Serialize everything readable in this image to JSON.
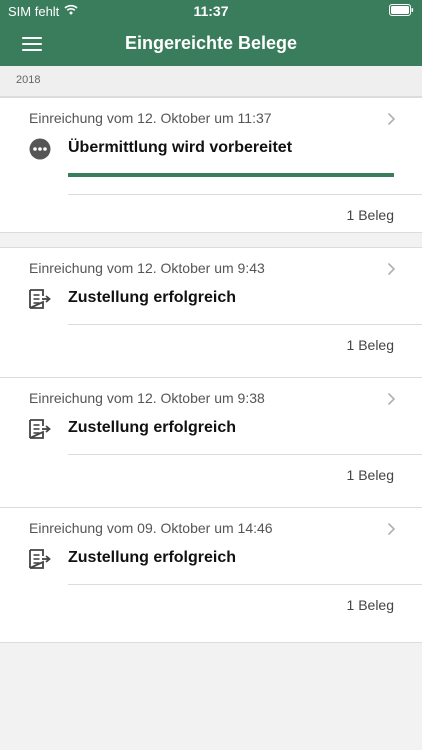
{
  "statusbar": {
    "carrier": "SIM fehlt",
    "time": "11:37"
  },
  "header": {
    "title": "Eingereichte Belege"
  },
  "section": {
    "label": "2018"
  },
  "colors": {
    "brand": "#3a7d5c",
    "background": "#f2f2f2",
    "card": "#ffffff"
  },
  "submissions": [
    {
      "date": "Einreichung vom 12. Oktober um 11:37",
      "status": "Übermittlung wird vorbereitet",
      "status_icon": "more-dots-icon",
      "progress": 1.0,
      "count": "1 Beleg"
    },
    {
      "date": "Einreichung vom 12. Oktober um 9:43",
      "status": "Zustellung erfolgreich",
      "status_icon": "document-sent-icon",
      "count": "1 Beleg"
    },
    {
      "date": "Einreichung vom 12. Oktober um 9:38",
      "status": "Zustellung erfolgreich",
      "status_icon": "document-sent-icon",
      "count": "1 Beleg"
    },
    {
      "date": "Einreichung vom 09. Oktober um 14:46",
      "status": "Zustellung erfolgreich",
      "status_icon": "document-sent-icon",
      "count": "1 Beleg"
    }
  ]
}
